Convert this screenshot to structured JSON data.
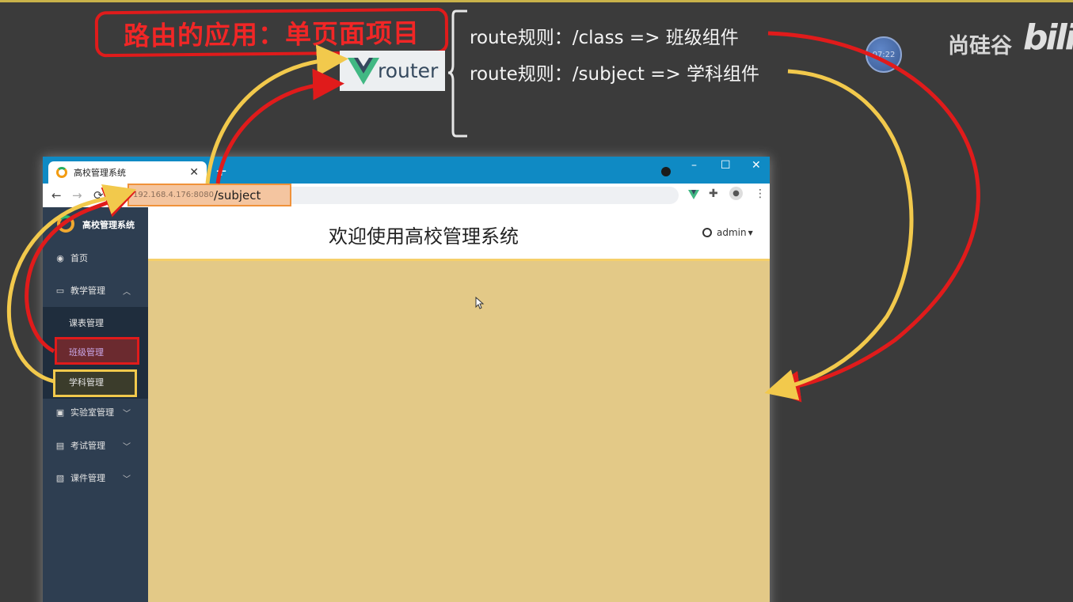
{
  "slide": {
    "title": "路由的应用：单页面项目",
    "router_logo_text": "router",
    "rules": [
      "route规则：/class =>  班级组件",
      "route规则：/subject => 学科组件"
    ]
  },
  "watermark": {
    "clock": "07:22",
    "brand": "尚硅谷",
    "bili": "bili"
  },
  "browser": {
    "tab_title": "高校管理系统",
    "tab_close": "✕",
    "new_tab": "+",
    "window_controls": [
      "–",
      "☐",
      "✕"
    ],
    "url_host": "192.168.4.176:8080",
    "url_path": "/subject"
  },
  "app": {
    "brand": "高校管理系统",
    "welcome": "欢迎使用高校管理系统",
    "user": "admin",
    "menu": [
      {
        "label": "首页",
        "icon": "dashboard-icon"
      },
      {
        "label": "教学管理",
        "icon": "monitor-icon"
      },
      {
        "label": "实验室管理",
        "icon": "lab-icon"
      },
      {
        "label": "考试管理",
        "icon": "printer-icon"
      },
      {
        "label": "课件管理",
        "icon": "word-file-icon"
      }
    ],
    "submenu": [
      "课表管理",
      "班级管理",
      "学科管理"
    ]
  },
  "colors": {
    "highlight_red": "#e01b1b",
    "highlight_yellow": "#f2c94c",
    "content_bg": "#e3c987",
    "sidebar_bg": "#2e3e51",
    "tabbar_bg": "#0f8ac4"
  }
}
